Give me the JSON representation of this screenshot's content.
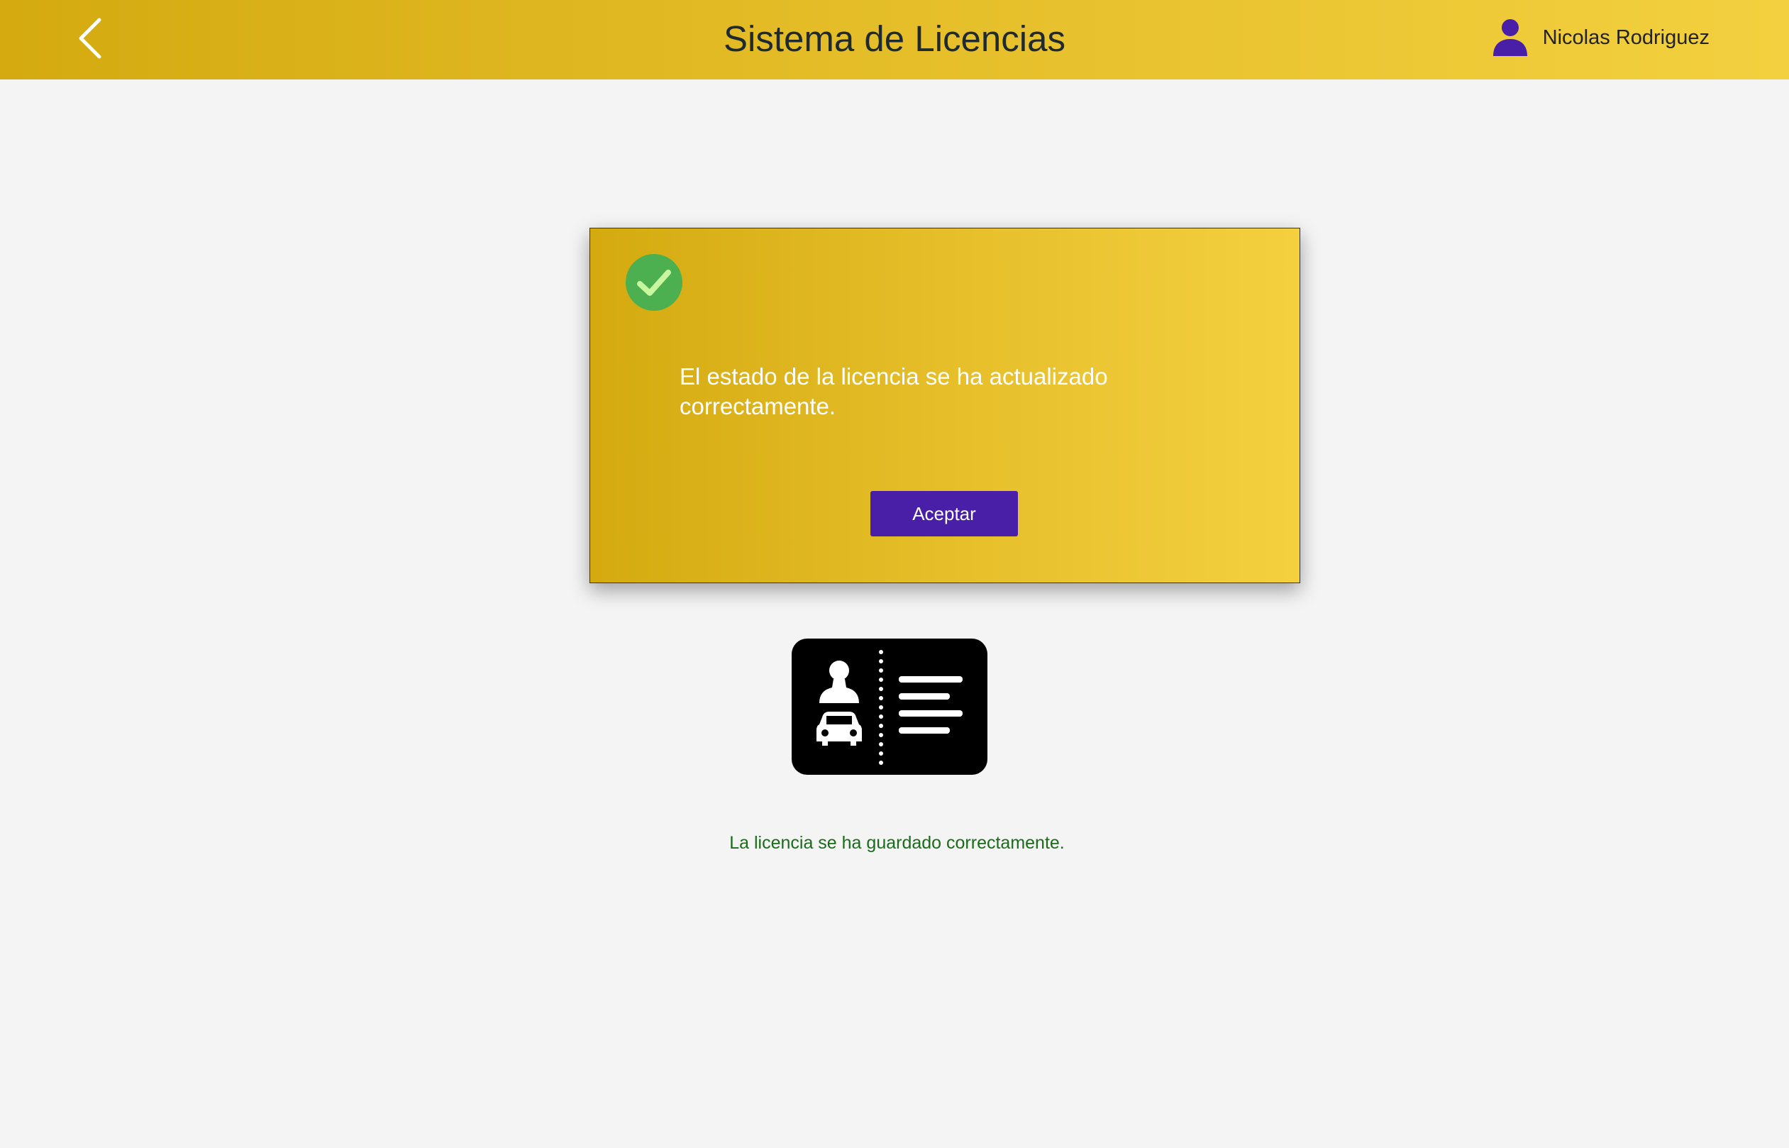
{
  "header": {
    "title": "Sistema de Licencias",
    "back_icon": "chevron-left-icon",
    "user": {
      "icon": "user-icon",
      "name": "Nicolas Rodriguez"
    }
  },
  "dialog": {
    "icon": "check-circle-icon",
    "message": "El estado de la licencia se ha actualizado correctamente.",
    "accept_label": "Aceptar"
  },
  "main": {
    "illustration": "driver-license-icon",
    "status_message": "La licencia se ha guardado correctamente."
  },
  "colors": {
    "header_gradient_start": "#d4aa10",
    "header_gradient_end": "#f3d03f",
    "accent_purple": "#4a1fa8",
    "success_green": "#4caf50",
    "status_text_green": "#1a6b1a",
    "background": "#f4f4f4"
  }
}
